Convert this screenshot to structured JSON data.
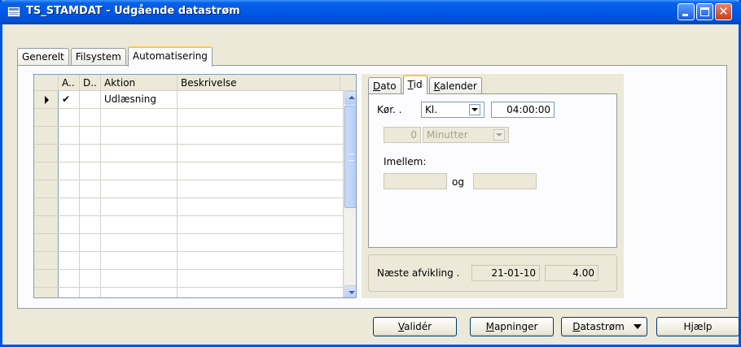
{
  "window": {
    "title": "TS_STAMDAT - Udgående datastrøm",
    "close_glyph": "✕"
  },
  "outer_tabs": [
    "Generelt",
    "Filsystem",
    "Automatisering"
  ],
  "grid": {
    "columns": [
      "A..",
      "D..",
      "Aktion",
      "Beskrivelse"
    ],
    "rows": [
      {
        "current": true,
        "checked": "✔",
        "d": "",
        "aktion": "Udlæsning",
        "beskrivelse": ""
      },
      {
        "checked": "",
        "d": "",
        "aktion": "",
        "beskrivelse": ""
      },
      {
        "checked": "",
        "d": "",
        "aktion": "",
        "beskrivelse": ""
      },
      {
        "checked": "",
        "d": "",
        "aktion": "",
        "beskrivelse": ""
      },
      {
        "checked": "",
        "d": "",
        "aktion": "",
        "beskrivelse": ""
      },
      {
        "checked": "",
        "d": "",
        "aktion": "",
        "beskrivelse": ""
      },
      {
        "checked": "",
        "d": "",
        "aktion": "",
        "beskrivelse": ""
      },
      {
        "checked": "",
        "d": "",
        "aktion": "",
        "beskrivelse": ""
      },
      {
        "checked": "",
        "d": "",
        "aktion": "",
        "beskrivelse": ""
      },
      {
        "checked": "",
        "d": "",
        "aktion": "",
        "beskrivelse": ""
      },
      {
        "checked": "",
        "d": "",
        "aktion": "",
        "beskrivelse": ""
      },
      {
        "checked": "",
        "d": "",
        "aktion": "",
        "beskrivelse": ""
      }
    ]
  },
  "inner_tabs": {
    "dato": {
      "u": "D",
      "rest": "ato"
    },
    "tid": {
      "u": "T",
      "rest": "id"
    },
    "kalender": {
      "u": "K",
      "rest": "alender"
    }
  },
  "tid": {
    "kor_label": "Kør. .",
    "kor_mode": "Kl.",
    "kor_time": "04:00:00",
    "interval_value": "0",
    "interval_unit": "Minutter",
    "imellem_label": "Imellem:",
    "imellem_from": "",
    "og_label": "og",
    "imellem_to": ""
  },
  "next_run": {
    "label": "Næste afvikling .",
    "date": "21-01-10",
    "time": "4.00"
  },
  "buttons": {
    "valider": {
      "u": "V",
      "rest": "alidér"
    },
    "mapninger": {
      "u": "M",
      "rest": "apninger"
    },
    "datastrom": {
      "u": "D",
      "rest": "atastrøm"
    },
    "hjaelp": "Hjælp"
  }
}
